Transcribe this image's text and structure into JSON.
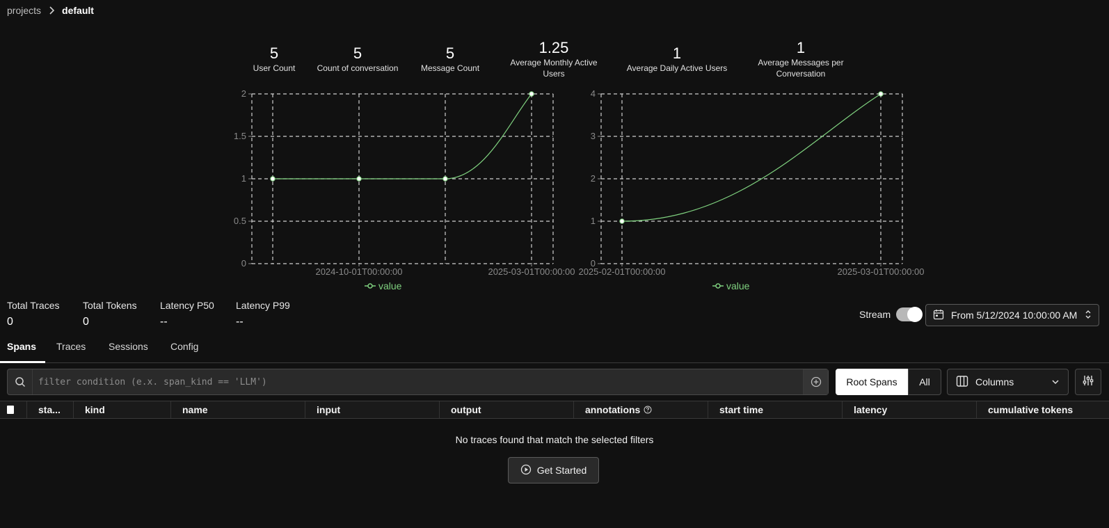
{
  "breadcrumb": {
    "parent": "projects",
    "current": "default"
  },
  "stats": [
    {
      "value": "5",
      "label": "User Count"
    },
    {
      "value": "5",
      "label": "Count of conversation"
    },
    {
      "value": "5",
      "label": "Message Count"
    },
    {
      "value": "1.25",
      "label": "Average Monthly Active Users"
    },
    {
      "value": "1",
      "label": "Average Daily Active Users"
    },
    {
      "value": "1",
      "label": "Average Messages per Conversation"
    }
  ],
  "chart_data": [
    {
      "type": "line",
      "x_ticks": [
        "2024-10-01T00:00:00",
        "2025-03-01T00:00:00"
      ],
      "y_ticks": [
        "0",
        "0.5",
        "1",
        "1.5",
        "2"
      ],
      "ylim": [
        0,
        2
      ],
      "grid": true,
      "legend": "bottom",
      "series": [
        {
          "name": "value",
          "values": [
            1,
            1,
            1,
            2
          ]
        }
      ],
      "color": "#7fd17f"
    },
    {
      "type": "line",
      "x_ticks": [
        "2025-02-01T00:00:00",
        "2025-03-01T00:00:00"
      ],
      "y_ticks": [
        "0",
        "1",
        "2",
        "3",
        "4"
      ],
      "ylim": [
        0,
        4
      ],
      "grid": true,
      "legend": "bottom",
      "series": [
        {
          "name": "value",
          "x": [
            "2025-02-01T00:00:00",
            "2025-03-01T00:00:00"
          ],
          "values": [
            1,
            4
          ]
        }
      ],
      "color": "#7fd17f"
    }
  ],
  "metrics": [
    {
      "label": "Total Traces",
      "value": "0"
    },
    {
      "label": "Total Tokens",
      "value": "0"
    },
    {
      "label": "Latency P50",
      "value": "--"
    },
    {
      "label": "Latency P99",
      "value": "--"
    }
  ],
  "stream": {
    "label": "Stream",
    "enabled": true
  },
  "date_range": {
    "label": "From 5/12/2024 10:00:00 AM"
  },
  "tabs": [
    {
      "label": "Spans",
      "active": true
    },
    {
      "label": "Traces",
      "active": false
    },
    {
      "label": "Sessions",
      "active": false
    },
    {
      "label": "Config",
      "active": false
    }
  ],
  "filter": {
    "placeholder": "filter condition (e.x. span_kind == 'LLM')",
    "value": ""
  },
  "span_toggle": {
    "root": "Root Spans",
    "all": "All",
    "selected": "Root Spans"
  },
  "columns_button": "Columns",
  "table": {
    "columns": [
      "sta...",
      "kind",
      "name",
      "input",
      "output",
      "annotations",
      "start time",
      "latency",
      "cumulative tokens"
    ],
    "empty_message": "No traces found that match the selected filters",
    "get_started": "Get Started"
  },
  "icons": [
    "chevron-right-icon",
    "calendar-icon",
    "search-icon",
    "plus-circle-icon",
    "columns-icon",
    "chevron-down-icon",
    "sliders-icon",
    "help-circle-icon",
    "play-circle-icon"
  ]
}
